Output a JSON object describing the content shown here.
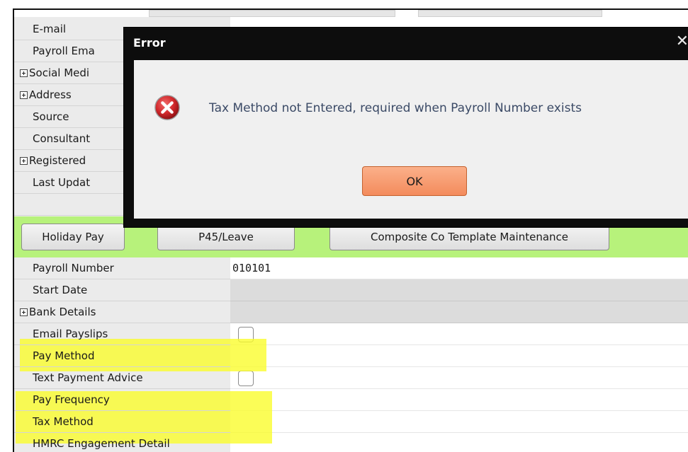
{
  "rows_top": [
    {
      "label": "E-mail",
      "expandable": false
    },
    {
      "label": "Payroll Ema",
      "expandable": false
    },
    {
      "label": "Social Medi",
      "expandable": true
    },
    {
      "label": "Address",
      "expandable": true
    },
    {
      "label": "Source",
      "expandable": false
    },
    {
      "label": "Consultant",
      "expandable": false
    },
    {
      "label": "Registered",
      "expandable": true
    },
    {
      "label": "Last Updat",
      "expandable": false
    }
  ],
  "toolbar": {
    "holiday_pay": "Holiday Pay",
    "p45_leave": "P45/Leave",
    "composite_template": "Composite Co Template Maintenance"
  },
  "rows_bottom": [
    {
      "label": "Payroll Number",
      "value": "010101",
      "expandable": false
    },
    {
      "label": "Start Date",
      "value": "",
      "expandable": false
    },
    {
      "label": "Bank Details",
      "value": "",
      "expandable": true
    },
    {
      "label": "Email Payslips",
      "value": "",
      "expandable": false,
      "checkbox": true,
      "checked": false
    },
    {
      "label": "Pay Method",
      "value": "",
      "expandable": false,
      "highlighted": true
    },
    {
      "label": "Text Payment Advice",
      "value": "",
      "expandable": false,
      "checkbox": true,
      "checked": false
    },
    {
      "label": "Pay Frequency",
      "value": "",
      "expandable": false,
      "highlighted": true
    },
    {
      "label": "Tax Method",
      "value": "",
      "expandable": false,
      "highlighted": true
    },
    {
      "label": "HMRC Engagement Detail",
      "value": "",
      "expandable": false
    }
  ],
  "dialog": {
    "title": "Error",
    "close_icon": "close-icon",
    "icon": "error-icon",
    "message": "Tax Method not Entered, required when Payroll Number exists",
    "ok_label": "OK"
  },
  "colors": {
    "toolbar_green": "#b7f27b",
    "highlight_yellow": "#fafc28",
    "ok_orange": "#f38b5c",
    "error_red": "#d0282b"
  }
}
